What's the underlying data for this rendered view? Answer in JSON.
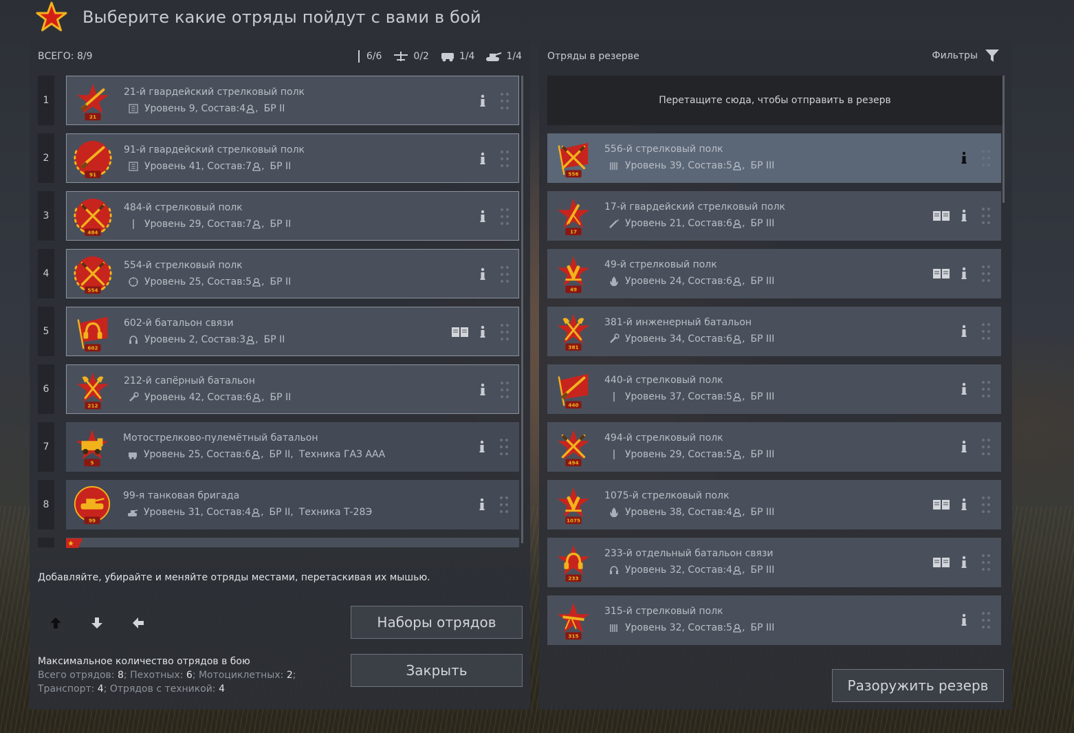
{
  "header": {
    "title": "Выберите какие отряды пойдут с вами в бой"
  },
  "left_panel": {
    "total_label": "ВСЕГО: 8/9",
    "counts": [
      {
        "icon": "infantry-icon",
        "value": "6/6"
      },
      {
        "icon": "aircraft-icon",
        "value": "0/2"
      },
      {
        "icon": "vehicle-icon",
        "value": "1/4"
      },
      {
        "icon": "tank-icon",
        "value": "1/4"
      }
    ],
    "squads": [
      {
        "num": "1",
        "title": "21-й гвардейский стрелковый полк",
        "type_icon": "rifle-icon",
        "sub": "Уровень 9, Состав:4",
        "br": "БР II",
        "extra": "",
        "emblem_num": "21",
        "emblem": "star-rifle",
        "book": false
      },
      {
        "num": "2",
        "title": "91-й гвардейский стрелковый полк",
        "type_icon": "rifle-icon",
        "sub": "Уровень 41, Состав:7",
        "br": "БР II",
        "extra": "",
        "emblem_num": "91",
        "emblem": "wreath-rifle",
        "book": false
      },
      {
        "num": "3",
        "title": "484-й стрелковый полк",
        "type_icon": "bayonet-icon",
        "sub": "Уровень 29, Состав:7",
        "br": "БР II",
        "extra": "",
        "emblem_num": "484",
        "emblem": "wreath-cross",
        "book": false
      },
      {
        "num": "4",
        "title": "554-й стрелковый полк",
        "type_icon": "scope-icon",
        "sub": "Уровень 25, Состав:5",
        "br": "БР II",
        "extra": "",
        "emblem_num": "554",
        "emblem": "wreath-cross",
        "book": false
      },
      {
        "num": "5",
        "title": "602-й батальон связи",
        "type_icon": "headphones-icon",
        "sub": "Уровень 2, Состав:3",
        "br": "БР II",
        "extra": "",
        "emblem_num": "602",
        "emblem": "flag-headphones",
        "book": true
      },
      {
        "num": "6",
        "title": "212-й сапёрный батальон",
        "type_icon": "wrench-icon",
        "sub": "Уровень 42, Состав:6",
        "br": "БР II",
        "extra": "",
        "emblem_num": "212",
        "emblem": "star-axes",
        "book": false
      },
      {
        "num": "7",
        "title": "Мотострелково-пулемётный батальон",
        "type_icon": "vehicle-icon",
        "sub": "Уровень 25, Состав:6",
        "br": "БР II,",
        "extra": "Техника ГАЗ ААА",
        "emblem_num": "5",
        "emblem": "star-truck",
        "book": false
      },
      {
        "num": "8",
        "title": "99-я танковая бригада",
        "type_icon": "tank-icon",
        "sub": "Уровень 31, Состав:4",
        "br": "БР II,",
        "extra": "Техника Т-28Э",
        "emblem_num": "99",
        "emblem": "circle-tank",
        "book": false
      }
    ],
    "hint": "Добавляйте, убирайте и меняйте отряды местами, перетаскивая их мышью.",
    "btn_sets": "Наборы отрядов",
    "btn_close": "Закрыть",
    "max_title": "Максимальное количество отрядов в бою",
    "max_line1": {
      "a": "Всего отрядов: ",
      "av": "8",
      "b": "; Пехотных: ",
      "bv": "6",
      "c": "; Мотоциклетных: ",
      "cv": "2",
      "d": ";"
    },
    "max_line2": {
      "a": "Транспорт: ",
      "av": "4",
      "b": "; Отрядов с техникой: ",
      "bv": "4"
    }
  },
  "right_panel": {
    "title": "Отряды в резерве",
    "filters": "Фильтры",
    "dropzone": "Перетащите сюда, чтобы отправить в резерв",
    "squads": [
      {
        "title": "556-й стрелковый полк",
        "type_icon": "mg-icon",
        "sub": "Уровень 39, Состав:5",
        "br": "БР III",
        "emblem_num": "556",
        "emblem": "flag-cross",
        "book": false,
        "selected": true
      },
      {
        "title": "17-й гвардейский стрелковый полк",
        "type_icon": "flamethrower-icon",
        "sub": "Уровень 21, Состав:6",
        "br": "БР III",
        "emblem_num": "17",
        "emblem": "star-mortar",
        "book": true,
        "selected": false
      },
      {
        "title": "49-й стрелковый полк",
        "type_icon": "flame-icon",
        "sub": "Уровень 24, Состав:6",
        "br": "БР III",
        "emblem_num": "49",
        "emblem": "star-shells",
        "book": true,
        "selected": false
      },
      {
        "title": "381-й инженерный батальон",
        "type_icon": "wrench-icon",
        "sub": "Уровень 34, Состав:6",
        "br": "БР III",
        "emblem_num": "381",
        "emblem": "star-axes",
        "book": false,
        "selected": false
      },
      {
        "title": "440-й стрелковый полк",
        "type_icon": "bayonet-icon",
        "sub": "Уровень 37, Состав:5",
        "br": "БР III",
        "emblem_num": "440",
        "emblem": "flag-rifle",
        "book": false,
        "selected": false
      },
      {
        "title": "494-й стрелковый полк",
        "type_icon": "bayonet-icon",
        "sub": "Уровень 29, Состав:5",
        "br": "БР III",
        "emblem_num": "494",
        "emblem": "star-cross",
        "book": false,
        "selected": false
      },
      {
        "title": "1075-й стрелковый полк",
        "type_icon": "flame-icon",
        "sub": "Уровень 38, Состав:4",
        "br": "БР III",
        "emblem_num": "1075",
        "emblem": "star-shells",
        "book": true,
        "selected": false
      },
      {
        "title": "233-й отдельный батальон связи",
        "type_icon": "headphones-icon",
        "sub": "Уровень 32, Состав:4",
        "br": "БР III",
        "emblem_num": "233",
        "emblem": "star-headphones",
        "book": true,
        "selected": false
      },
      {
        "title": "315-й стрелковый полк",
        "type_icon": "mg-icon",
        "sub": "Уровень 32, Состав:5",
        "br": "БР III",
        "emblem_num": "315",
        "emblem": "star-mg",
        "book": false,
        "selected": false
      }
    ],
    "btn_disarm": "Разоружить резерв"
  },
  "colors": {
    "accent_red": "#c8241e",
    "gold": "#f2b21c",
    "panel": "#2c2f36",
    "card": "#4a505b",
    "selected": "#5b6777"
  }
}
